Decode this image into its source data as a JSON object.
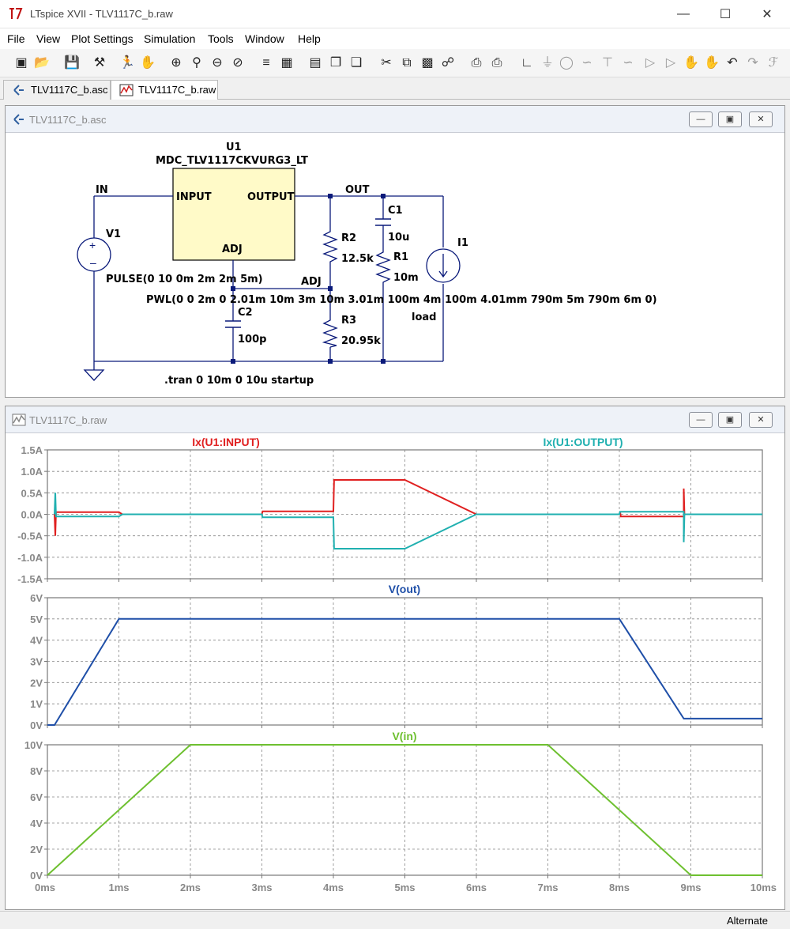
{
  "window": {
    "title": "LTspice XVII - TLV1117C_b.raw"
  },
  "menu": [
    "File",
    "View",
    "Plot Settings",
    "Simulation",
    "Tools",
    "Window",
    "Help"
  ],
  "tabs": [
    {
      "label": "TLV1117C_b.asc",
      "icon": "schematic-icon"
    },
    {
      "label": "TLV1117C_b.raw",
      "icon": "waveform-icon"
    }
  ],
  "schematic_window": {
    "title": "TLV1117C_b.asc"
  },
  "waveform_window": {
    "title": "TLV1117C_b.raw"
  },
  "schematic": {
    "u1_name": "U1",
    "u1_model": "MDC_TLV1117CKVURG3_LT",
    "pin_input": "INPUT",
    "pin_output": "OUTPUT",
    "pin_adj": "ADJ",
    "net_in": "IN",
    "net_out": "OUT",
    "net_adj": "ADJ",
    "v1_name": "V1",
    "v1_value": "PULSE(0 10 0m 2m 2m 5m)",
    "i1_name": "I1",
    "i1_value": "PWL(0 0 2m 0 2.01m 10m 3m 10m 3.01m 100m 4m 100m 4.01mm 790m 5m 790m 6m 0)",
    "i1_label": "load",
    "c1_name": "C1",
    "c1_value": "10u",
    "c2_name": "C2",
    "c2_value": "100p",
    "r1_name": "R1",
    "r1_value": "10m",
    "r2_name": "R2",
    "r2_value": "12.5k",
    "r3_name": "R3",
    "r3_value": "20.95k",
    "directive": ".tran 0 10m 0 10u startup"
  },
  "chart_data": [
    {
      "type": "line",
      "title": "",
      "series": [
        {
          "name": "Ix(U1:INPUT)",
          "color": "#e02020",
          "points": [
            [
              0.1,
              0.0
            ],
            [
              0.11,
              -0.5
            ],
            [
              0.12,
              0.05
            ],
            [
              1.0,
              0.05
            ],
            [
              1.05,
              0.0
            ],
            [
              3.0,
              0.0
            ],
            [
              3.01,
              0.07
            ],
            [
              4.0,
              0.07
            ],
            [
              4.01,
              0.8
            ],
            [
              5.0,
              0.8
            ],
            [
              6.0,
              0.0
            ],
            [
              8.0,
              0.0
            ],
            [
              8.01,
              0.06
            ],
            [
              8.02,
              -0.05
            ],
            [
              8.9,
              -0.05
            ],
            [
              8.9,
              0.6
            ],
            [
              8.91,
              0.0
            ],
            [
              10.0,
              0.0
            ]
          ]
        },
        {
          "name": "Ix(U1:OUTPUT)",
          "color": "#20b0b0",
          "points": [
            [
              0.1,
              0.0
            ],
            [
              0.11,
              0.5
            ],
            [
              0.12,
              -0.05
            ],
            [
              1.0,
              -0.05
            ],
            [
              1.05,
              0.0
            ],
            [
              3.0,
              0.0
            ],
            [
              3.01,
              -0.07
            ],
            [
              4.0,
              -0.07
            ],
            [
              4.01,
              -0.8
            ],
            [
              5.0,
              -0.8
            ],
            [
              6.0,
              0.0
            ],
            [
              8.0,
              0.0
            ],
            [
              8.01,
              0.06
            ],
            [
              8.9,
              0.06
            ],
            [
              8.9,
              -0.65
            ],
            [
              8.91,
              0.0
            ],
            [
              10.0,
              0.0
            ]
          ]
        }
      ],
      "ylim": [
        -1.5,
        1.5
      ],
      "yticks": [
        "1.5A",
        "1.0A",
        "0.5A",
        "0.0A",
        "-0.5A",
        "-1.0A",
        "-1.5A"
      ],
      "ytick_values": [
        1.5,
        1.0,
        0.5,
        0.0,
        -0.5,
        -1.0,
        -1.5
      ]
    },
    {
      "type": "line",
      "title": "V(out)",
      "series": [
        {
          "name": "V(out)",
          "color": "#1f4fa8",
          "points": [
            [
              0.0,
              0.0
            ],
            [
              0.1,
              0.0
            ],
            [
              1.0,
              5.0
            ],
            [
              8.0,
              5.0
            ],
            [
              8.9,
              0.3
            ],
            [
              10.0,
              0.3
            ]
          ]
        }
      ],
      "ylim": [
        0,
        6
      ],
      "yticks": [
        "6V",
        "5V",
        "4V",
        "3V",
        "2V",
        "1V",
        "0V"
      ],
      "ytick_values": [
        6,
        5,
        4,
        3,
        2,
        1,
        0
      ]
    },
    {
      "type": "line",
      "title": "V(in)",
      "series": [
        {
          "name": "V(in)",
          "color": "#6ec030",
          "points": [
            [
              0.0,
              0.0
            ],
            [
              2.0,
              10.0
            ],
            [
              7.0,
              10.0
            ],
            [
              9.0,
              0.0
            ],
            [
              10.0,
              0.0
            ]
          ]
        }
      ],
      "ylim": [
        0,
        10
      ],
      "yticks": [
        "10V",
        "8V",
        "6V",
        "4V",
        "2V",
        "0V"
      ],
      "ytick_values": [
        10,
        8,
        6,
        4,
        2,
        0
      ]
    }
  ],
  "x_axis": {
    "ticks": [
      "0ms",
      "1ms",
      "2ms",
      "3ms",
      "4ms",
      "5ms",
      "6ms",
      "7ms",
      "8ms",
      "9ms",
      "10ms"
    ],
    "xlim": [
      0,
      10
    ]
  },
  "status": {
    "mode": "Alternate"
  }
}
